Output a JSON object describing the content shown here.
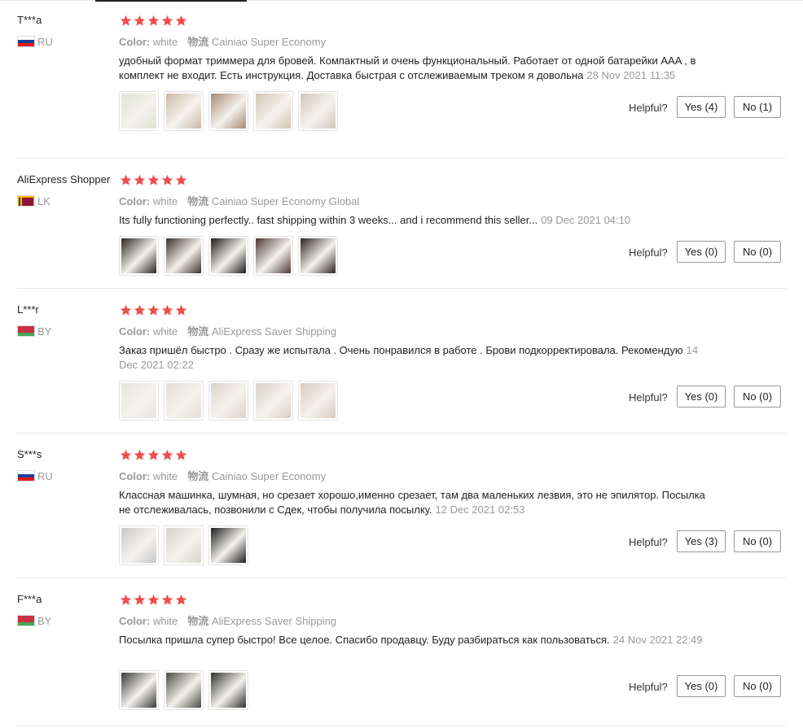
{
  "ui": {
    "color_label": "Color:",
    "shipping_label": "物流",
    "helpful_label": "Helpful?"
  },
  "colors": {
    "star": "#f04d4d",
    "divider": "#e8e8e8",
    "muted_text": "#999999"
  },
  "reviews": [
    {
      "user": "T***a",
      "country": "RU",
      "flag": "russia-flag-icon",
      "rating": 5,
      "color": "white",
      "shipping": "Cainiao Super Economy",
      "text": "удобный формат триммера для бровей. Компактный и очень функциональный. Работает от одной батарейки AAA , в комплект не входит. Есть инструкция. Доставка быстрая с отслеживаемым треком я довольна",
      "date": "28 Nov 2021 11:35",
      "photo_count": 5,
      "yes_label": "Yes (4)",
      "no_label": "No (1)"
    },
    {
      "user": "AliExpress Shopper",
      "country": "LK",
      "flag": "sri-lanka-flag-icon",
      "rating": 5,
      "color": "white",
      "shipping": "Cainiao Super Economy Global",
      "text": "Its fully functioning perfectly.. fast shipping within 3 weeks... and i recommend this seller...",
      "date": "09 Dec 2021 04:10",
      "photo_count": 5,
      "yes_label": "Yes (0)",
      "no_label": "No (0)"
    },
    {
      "user": "L***r",
      "country": "BY",
      "flag": "belarus-flag-icon",
      "rating": 5,
      "color": "white",
      "shipping": "AliExpress Saver Shipping",
      "text": "Заказ пришёл быстро . Сразу же испытала . Очень понравился в работе . Брови подкорректировала. Рекомендую",
      "date": "14 Dec 2021 02:22",
      "photo_count": 5,
      "yes_label": "Yes (0)",
      "no_label": "No (0)"
    },
    {
      "user": "S***s",
      "country": "RU",
      "flag": "russia-flag-icon",
      "rating": 5,
      "color": "white",
      "shipping": "Cainiao Super Economy",
      "text": "Классная машинка, шумная, но срезает хорошо,именно срезает, там два маленьких лезвия, это не эпилятор. Посылка не отслеживалась, позвонили с Сдек, чтобы получила посылку.",
      "date": "12 Dec 2021 02:53",
      "photo_count": 3,
      "yes_label": "Yes (3)",
      "no_label": "No (0)"
    },
    {
      "user": "F***a",
      "country": "BY",
      "flag": "belarus-flag-icon",
      "rating": 5,
      "color": "white",
      "shipping": "AliExpress Saver Shipping",
      "text": "Посылка пришла супер быстро! Все целое. Спасибо продавцу. Буду разбираться как пользоваться.",
      "date": "24 Nov 2021 22:49",
      "photo_count": 3,
      "yes_label": "Yes (0)",
      "no_label": "No (0)"
    }
  ]
}
